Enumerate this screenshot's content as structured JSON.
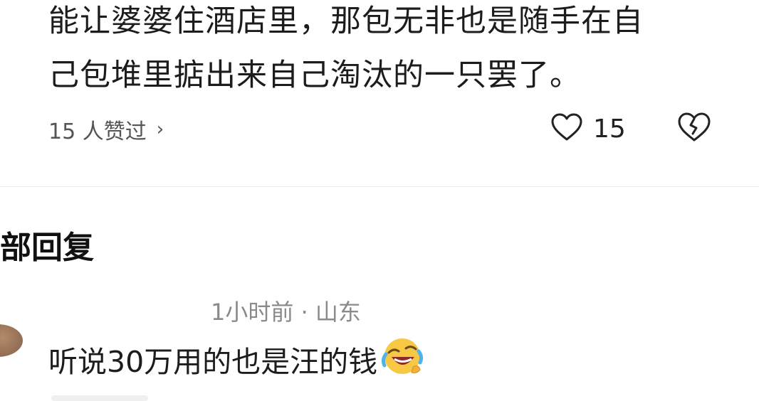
{
  "post": {
    "lines": [
      "能让婆婆住酒店里，那包无非也是随手在自",
      "己包堆里掂出来自己淘汰的一只罢了。"
    ]
  },
  "actions": {
    "likers_text": "15 人赞过",
    "chevron": "›",
    "like_count": "15"
  },
  "replies_section": {
    "title": "部回复"
  },
  "reply": {
    "time": "1小时前",
    "separator": " · ",
    "location": "山东",
    "text": "听说30万用的也是汪的钱",
    "emoji_name": "rolling-on-floor-laughing-icon"
  }
}
